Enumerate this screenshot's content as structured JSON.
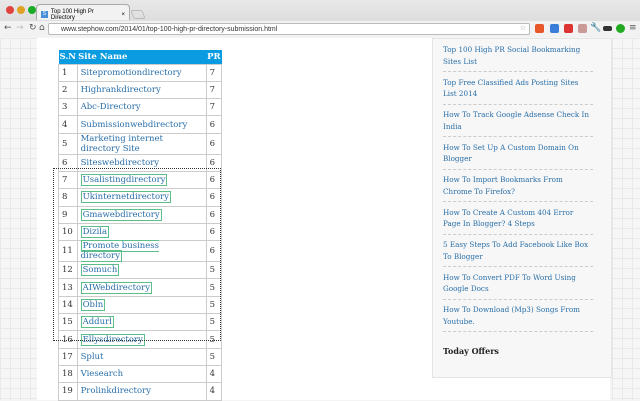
{
  "browser": {
    "tab_title": "Top 100 High Pr Directory",
    "tab_favicon": "S",
    "url": "www.stephow.com/2014/01/top-100-high-pr-directory-submission.html"
  },
  "table": {
    "headers": [
      "S.N",
      "Site Name",
      "PR"
    ],
    "rows": [
      [
        "1",
        "Sitepromotiondirectory",
        "7"
      ],
      [
        "2",
        "Highrankdirectory",
        "7"
      ],
      [
        "3",
        "Abc-Directory",
        "7"
      ],
      [
        "4",
        "Submissionwebdirectory",
        "6"
      ],
      [
        "5",
        "Marketing internet directory Site",
        "6"
      ],
      [
        "6",
        "Siteswebdirectory",
        "6"
      ],
      [
        "7",
        "Usalistingdirectory",
        "6"
      ],
      [
        "8",
        "Ukinternetdirectory",
        "6"
      ],
      [
        "9",
        "Gmawebdirectory",
        "6"
      ],
      [
        "10",
        "Dizila",
        "6"
      ],
      [
        "11",
        "Promote business directory",
        "6"
      ],
      [
        "12",
        "Somuch",
        "5"
      ],
      [
        "13",
        "AIWebdirectory",
        "5"
      ],
      [
        "14",
        "Obln",
        "5"
      ],
      [
        "15",
        "Addurl",
        "5"
      ],
      [
        "16",
        "Ellysdirectory",
        "5"
      ],
      [
        "17",
        "Splut",
        "5"
      ],
      [
        "18",
        "Viesearch",
        "4"
      ],
      [
        "19",
        "Prolinkdirectory",
        "4"
      ]
    ]
  },
  "sidebar": {
    "links": [
      "Top 100 High PR Social Bookmarking Sites List",
      "Top Free Classified Ads Posting Sites List 2014",
      "How To Track Google Adsense Check In India",
      "How To Set Up A Custom Domain On Blogger",
      "How To Import Bookmarks From Chrome To Firefox?",
      "How To Create A Custom 404 Error Page In Blogger? 4 Steps",
      "5 Easy Steps To Add Facebook Like Box To Blogger",
      "How To Convert PDF To Word Using Google Docs",
      "How To Download (Mp3) Songs From Youtube."
    ],
    "heading": "Today Offers"
  },
  "colors": {
    "header": "#0a9be0",
    "link": "#2a6fa8"
  }
}
